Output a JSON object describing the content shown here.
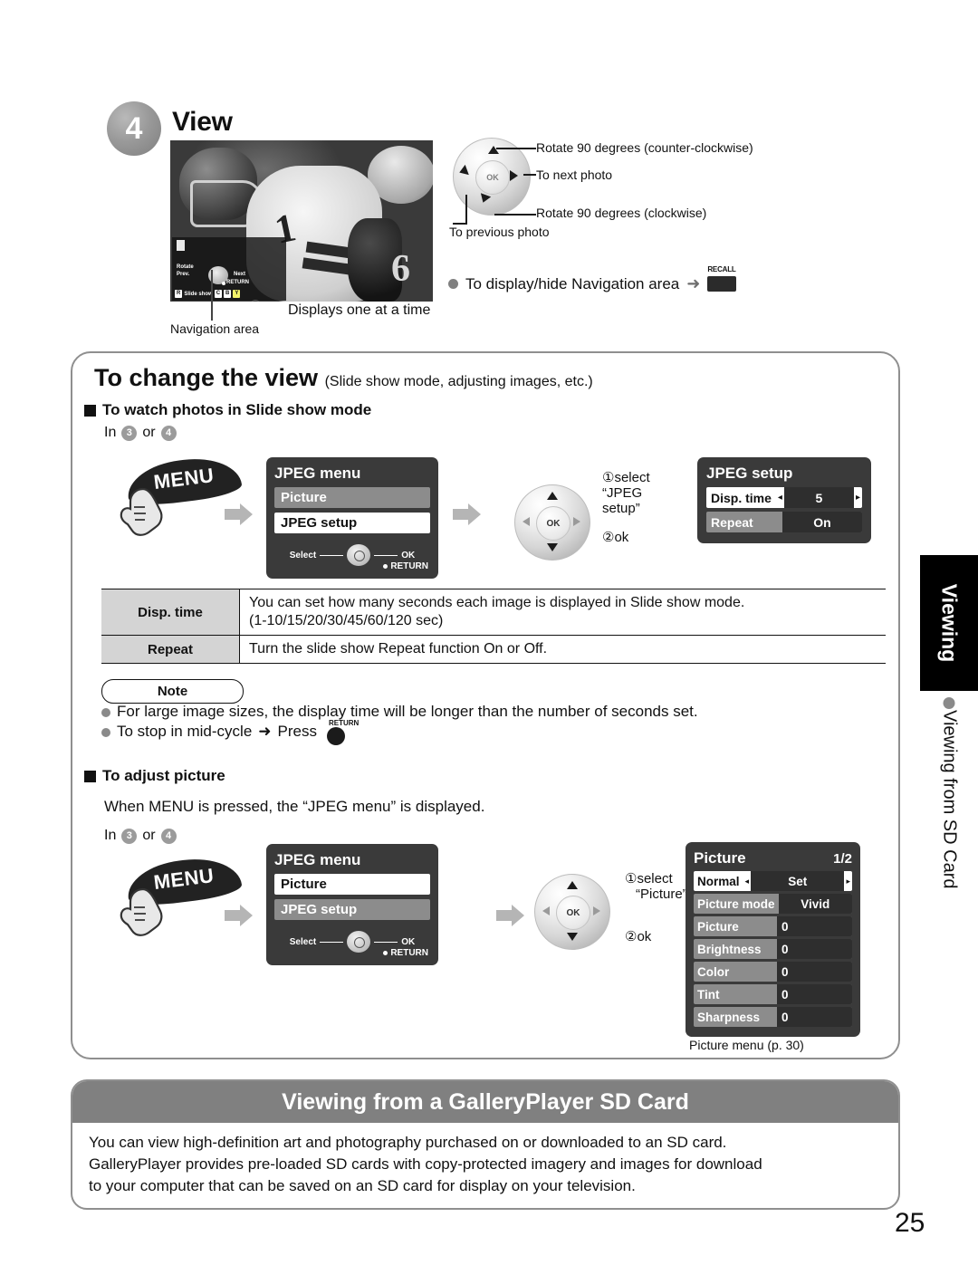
{
  "step": {
    "number": "4",
    "title": "View"
  },
  "photo": {
    "nav_overlay": {
      "rotate": "Rotate",
      "prev": "Prev.",
      "next": "Next",
      "return": "RETURN",
      "slideshow": "Slide show",
      "key_r": "R",
      "key_1": "C",
      "key_2": "B",
      "key_3": "Y"
    },
    "nav_label": "Navigation area",
    "caption": "Displays one at a time"
  },
  "pad_callouts": {
    "ccw": "Rotate 90 degrees (counter-clockwise)",
    "next": "To next photo",
    "cw": "Rotate 90 degrees (clockwise)",
    "prev": "To previous photo",
    "ok": "OK"
  },
  "recall": {
    "bullet_text": "To display/hide Navigation area",
    "arrow": "➜",
    "button_label": "RECALL"
  },
  "view_section": {
    "title": "To change the view",
    "subtitle": "(Slide show mode, adjusting images, etc.)",
    "sec1_heading": "To watch photos in Slide show mode",
    "sec2_heading": "To adjust picture",
    "in_prefix": "In",
    "in_or": "or",
    "in_step_a": "3",
    "in_step_b": "4",
    "adjust_text": "When MENU is pressed, the “JPEG menu” is displayed."
  },
  "menu_button": {
    "label": "MENU"
  },
  "jpeg_menu_1": {
    "title": "JPEG menu",
    "row_unselected": "Picture",
    "row_selected": "JPEG setup",
    "guide_select": "Select",
    "guide_ok": "OK",
    "guide_return": "RETURN"
  },
  "jpeg_menu_2": {
    "title": "JPEG menu",
    "row_selected": "Picture",
    "row_unselected": "JPEG setup",
    "guide_select": "Select",
    "guide_ok": "OK",
    "guide_return": "RETURN"
  },
  "pad_mid_1": {
    "ok": "OK",
    "step1": "①select",
    "step1b": "“JPEG",
    "step1c": "setup”",
    "step2": "②ok"
  },
  "pad_mid_2": {
    "ok": "OK",
    "step1": "①select",
    "step1b": "“Picture”",
    "step2": "②ok"
  },
  "jpeg_setup_panel": {
    "title": "JPEG setup",
    "rows": [
      {
        "key": "Disp. time",
        "value": "5",
        "selected": true,
        "left_caret": "◂",
        "right_caret": "▸"
      },
      {
        "key": "Repeat",
        "value": "On",
        "selected": false
      }
    ]
  },
  "desc_table": {
    "rows": [
      {
        "key": "Disp. time",
        "line1": "You can set how many seconds each image is displayed in Slide show mode.",
        "line2": "(1-10/15/20/30/45/60/120 sec)"
      },
      {
        "key": "Repeat",
        "line1": "Turn the slide show Repeat function On or Off.",
        "line2": ""
      }
    ]
  },
  "note": {
    "label": "Note",
    "item1": "For large image sizes, the display time will be longer than the number of seconds set.",
    "item2_pre": "To stop in mid-cycle",
    "item2_arrow": "➜",
    "item2_post": "Press",
    "item2_button": "RETURN"
  },
  "picture_panel": {
    "title": "Picture",
    "page": "1/2",
    "rows": [
      {
        "key": "Normal",
        "value": "Set",
        "selected": true,
        "centered": true
      },
      {
        "key": "Picture mode",
        "value": "Vivid",
        "selected": false,
        "centered": true
      },
      {
        "key": "Picture",
        "value": "0",
        "selected": false,
        "centered": false
      },
      {
        "key": "Brightness",
        "value": "0",
        "selected": false,
        "centered": false
      },
      {
        "key": "Color",
        "value": "0",
        "selected": false,
        "centered": false
      },
      {
        "key": "Tint",
        "value": "0",
        "selected": false,
        "centered": false
      },
      {
        "key": "Sharpness",
        "value": "0",
        "selected": false,
        "centered": false
      }
    ],
    "caption": "Picture menu (p. 30)"
  },
  "side_tab": {
    "main": "Viewing",
    "sub": "Viewing from SD Card"
  },
  "gallery": {
    "heading": "Viewing from a GalleryPlayer SD Card",
    "body_line1": "You can view high-definition art and photography purchased on or downloaded to an SD card.",
    "body_line2": "GalleryPlayer provides pre-loaded SD cards with copy-protected imagery and images for download",
    "body_line3": "to your computer that can be saved on an SD card for display on your television."
  },
  "page_number": "25",
  "colors": {
    "accent_gray": "#808080",
    "panel_dark": "#3a3a3a",
    "row_unselected": "#8c8c8c",
    "table_key_bg": "#d4d4d4"
  }
}
